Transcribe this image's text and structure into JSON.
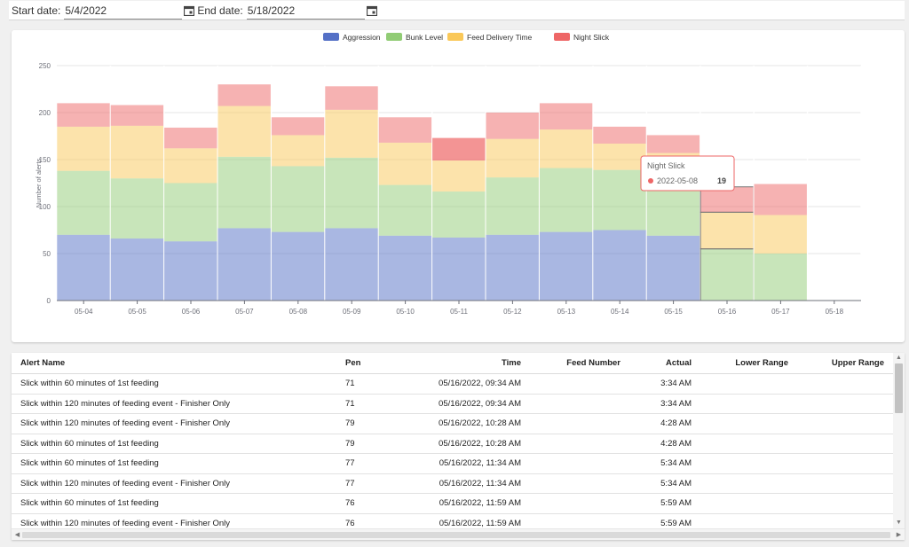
{
  "filters": {
    "start_label": "Start date:",
    "start_value": "5/4/2022",
    "end_label": "End date:",
    "end_value": "5/18/2022",
    "calendar_icon": "calendar-icon"
  },
  "chart_data": {
    "type": "bar",
    "stacked": true,
    "ylabel": "Number of alerts",
    "ylim": [
      0,
      250
    ],
    "yticks": [
      0,
      50,
      100,
      150,
      200,
      250
    ],
    "grid": true,
    "legend_position": "top-center",
    "categories": [
      "05-04",
      "05-05",
      "05-06",
      "05-07",
      "05-08",
      "05-09",
      "05-10",
      "05-11",
      "05-12",
      "05-13",
      "05-14",
      "05-15",
      "05-16",
      "05-17",
      "05-18"
    ],
    "series": [
      {
        "name": "Aggression",
        "color": "#5470c6",
        "values": [
          70,
          66,
          63,
          77,
          73,
          77,
          69,
          67,
          70,
          73,
          75,
          69,
          0,
          0,
          0
        ]
      },
      {
        "name": "Bunk Level",
        "color": "#91cc75",
        "values": [
          68,
          64,
          62,
          76,
          70,
          75,
          54,
          49,
          61,
          68,
          64,
          60,
          55,
          50,
          0
        ]
      },
      {
        "name": "Feed Delivery Time",
        "color": "#fac858",
        "values": [
          47,
          56,
          37,
          54,
          33,
          51,
          45,
          33,
          41,
          41,
          28,
          28,
          39,
          41,
          0
        ]
      },
      {
        "name": "Night Slick",
        "color": "#ee6666",
        "values": [
          25,
          22,
          22,
          23,
          19,
          25,
          27,
          24,
          28,
          28,
          18,
          19,
          27,
          33,
          0
        ]
      }
    ],
    "highlight": {
      "category_index": 7,
      "series_index": 3
    },
    "hover_category_index": 12,
    "tooltip": {
      "series": "Night Slick",
      "date": "2022-05-08",
      "value": "19"
    }
  },
  "table": {
    "headers": {
      "alert_name": "Alert Name",
      "pen": "Pen",
      "time": "Time",
      "feed_number": "Feed Number",
      "actual": "Actual",
      "lower_range": "Lower Range",
      "upper_range": "Upper Range"
    },
    "rows": [
      {
        "alert_name": "Slick within 60 minutes of 1st feeding",
        "pen": "71",
        "time": "05/16/2022, 09:34 AM",
        "feed_number": "",
        "actual": "3:34 AM",
        "lower_range": "",
        "upper_range": ""
      },
      {
        "alert_name": "Slick within 120 minutes of feeding event - Finisher Only",
        "pen": "71",
        "time": "05/16/2022, 09:34 AM",
        "feed_number": "",
        "actual": "3:34 AM",
        "lower_range": "",
        "upper_range": ""
      },
      {
        "alert_name": "Slick within 120 minutes of feeding event - Finisher Only",
        "pen": "79",
        "time": "05/16/2022, 10:28 AM",
        "feed_number": "",
        "actual": "4:28 AM",
        "lower_range": "",
        "upper_range": ""
      },
      {
        "alert_name": "Slick within 60 minutes of 1st feeding",
        "pen": "79",
        "time": "05/16/2022, 10:28 AM",
        "feed_number": "",
        "actual": "4:28 AM",
        "lower_range": "",
        "upper_range": ""
      },
      {
        "alert_name": "Slick within 60 minutes of 1st feeding",
        "pen": "77",
        "time": "05/16/2022, 11:34 AM",
        "feed_number": "",
        "actual": "5:34 AM",
        "lower_range": "",
        "upper_range": ""
      },
      {
        "alert_name": "Slick within 120 minutes of feeding event - Finisher Only",
        "pen": "77",
        "time": "05/16/2022, 11:34 AM",
        "feed_number": "",
        "actual": "5:34 AM",
        "lower_range": "",
        "upper_range": ""
      },
      {
        "alert_name": "Slick within 60 minutes of 1st feeding",
        "pen": "76",
        "time": "05/16/2022, 11:59 AM",
        "feed_number": "",
        "actual": "5:59 AM",
        "lower_range": "",
        "upper_range": ""
      },
      {
        "alert_name": "Slick within 120 minutes of feeding event - Finisher Only",
        "pen": "76",
        "time": "05/16/2022, 11:59 AM",
        "feed_number": "",
        "actual": "5:59 AM",
        "lower_range": "",
        "upper_range": ""
      }
    ]
  }
}
